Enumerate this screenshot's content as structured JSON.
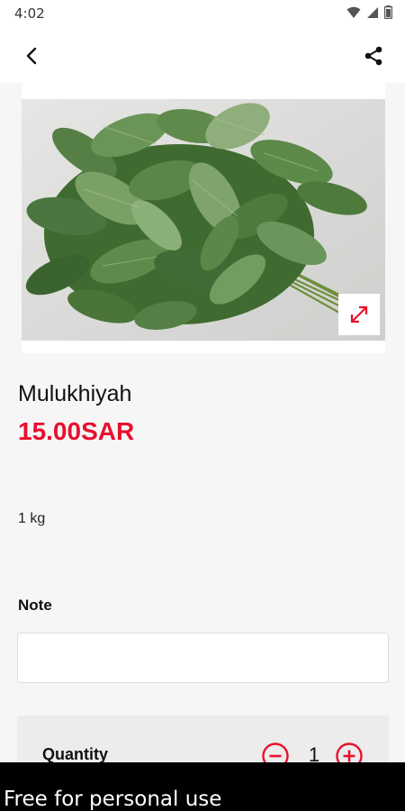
{
  "status_bar": {
    "time": "4:02",
    "icons": [
      "wifi-icon",
      "signal-icon",
      "battery-icon"
    ]
  },
  "app_bar": {
    "back_icon": "back-arrow-icon",
    "share_icon": "share-icon"
  },
  "product": {
    "image_alt": "leafy green bunch",
    "expand_icon": "expand-icon",
    "name": "Mulukhiyah",
    "price": "15.00SAR",
    "unit": "1 kg"
  },
  "note": {
    "label": "Note",
    "value": "",
    "placeholder": ""
  },
  "quantity": {
    "label": "Quantity",
    "value": "1",
    "minus_icon": "minus-circle-icon",
    "plus_icon": "plus-circle-icon"
  },
  "watermark": {
    "text": "Free for personal use"
  },
  "colors": {
    "accent": "#e8102e",
    "background": "#f6f6f6",
    "card": "#ffffff"
  }
}
